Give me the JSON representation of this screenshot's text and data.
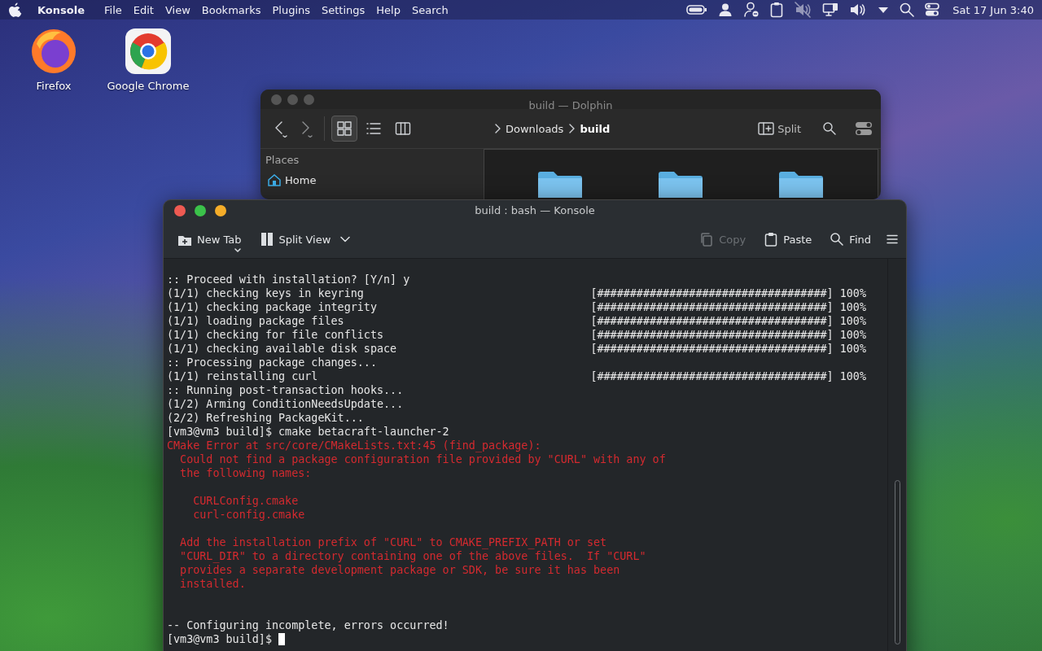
{
  "menubar": {
    "app": "Konsole",
    "menus": [
      "File",
      "Edit",
      "View",
      "Bookmarks",
      "Plugins",
      "Settings",
      "Help",
      "Search"
    ],
    "tray": [
      {
        "kind": "battery"
      },
      {
        "kind": "user"
      },
      {
        "kind": "user-minus"
      },
      {
        "kind": "clipboard"
      },
      {
        "kind": "muted"
      },
      {
        "kind": "network"
      },
      {
        "kind": "volume"
      },
      {
        "kind": "expand"
      },
      {
        "kind": "search"
      },
      {
        "kind": "toggles"
      }
    ],
    "clock": "Sat 17 Jun 3:40"
  },
  "desktop_icons": [
    {
      "label": "Firefox",
      "kind": "firefox"
    },
    {
      "label": "Google Chrome",
      "kind": "chrome"
    }
  ],
  "dolphin": {
    "title": "build — Dolphin",
    "view_modes": [
      {
        "kind": "icons",
        "selected": true
      },
      {
        "kind": "details",
        "selected": false
      },
      {
        "kind": "columns",
        "selected": false
      }
    ],
    "breadcrumb": [
      {
        "label": "Downloads",
        "current": false
      },
      {
        "label": "build",
        "current": true
      }
    ],
    "split": "Split",
    "places_heading": "Places",
    "places": [
      {
        "label": "Home",
        "kind": "home"
      }
    ]
  },
  "konsole": {
    "title": "build : bash — Konsole",
    "toolbar": [
      {
        "kind": "new-tab",
        "label": "New Tab",
        "disabled": false
      },
      {
        "kind": "split-view",
        "label": "Split View",
        "disabled": false
      },
      {
        "kind": "copy",
        "label": "Copy",
        "disabled": true
      },
      {
        "kind": "paste",
        "label": "Paste",
        "disabled": false
      },
      {
        "kind": "find",
        "label": "Find",
        "disabled": false
      }
    ],
    "lines": [
      {
        "kind": "output",
        "text": ":: Proceed with installation? [Y/n] y"
      },
      {
        "kind": "output",
        "text": "(1/1) checking keys in keyring",
        "progress": "[###################################] 100%"
      },
      {
        "kind": "output",
        "text": "(1/1) checking package integrity",
        "progress": "[###################################] 100%"
      },
      {
        "kind": "output",
        "text": "(1/1) loading package files",
        "progress": "[###################################] 100%"
      },
      {
        "kind": "output",
        "text": "(1/1) checking for file conflicts",
        "progress": "[###################################] 100%"
      },
      {
        "kind": "output",
        "text": "(1/1) checking available disk space",
        "progress": "[###################################] 100%"
      },
      {
        "kind": "output",
        "text": ":: Processing package changes..."
      },
      {
        "kind": "output",
        "text": "(1/1) reinstalling curl",
        "progress": "[###################################] 100%"
      },
      {
        "kind": "output",
        "text": ":: Running post-transaction hooks..."
      },
      {
        "kind": "output",
        "text": "(1/2) Arming ConditionNeedsUpdate..."
      },
      {
        "kind": "output",
        "text": "(2/2) Refreshing PackageKit..."
      },
      {
        "kind": "output",
        "text": "[vm3@vm3 build]$ cmake betacraft-launcher-2"
      },
      {
        "kind": "error",
        "text": "CMake Error at src/core/CMakeLists.txt:45 (find_package):"
      },
      {
        "kind": "error",
        "text": "  Could not find a package configuration file provided by \"CURL\" with any of"
      },
      {
        "kind": "error",
        "text": "  the following names:"
      },
      {
        "kind": "blank"
      },
      {
        "kind": "error",
        "text": "    CURLConfig.cmake"
      },
      {
        "kind": "error",
        "text": "    curl-config.cmake"
      },
      {
        "kind": "blank"
      },
      {
        "kind": "error",
        "text": "  Add the installation prefix of \"CURL\" to CMAKE_PREFIX_PATH or set"
      },
      {
        "kind": "error",
        "text": "  \"CURL_DIR\" to a directory containing one of the above files.  If \"CURL\""
      },
      {
        "kind": "error",
        "text": "  provides a separate development package or SDK, be sure it has been"
      },
      {
        "kind": "error",
        "text": "  installed."
      },
      {
        "kind": "blank"
      },
      {
        "kind": "blank"
      },
      {
        "kind": "output",
        "text": "-- Configuring incomplete, errors occurred!"
      },
      {
        "kind": "prompt",
        "text": "[vm3@vm3 build]$",
        "cursor": true
      }
    ]
  }
}
